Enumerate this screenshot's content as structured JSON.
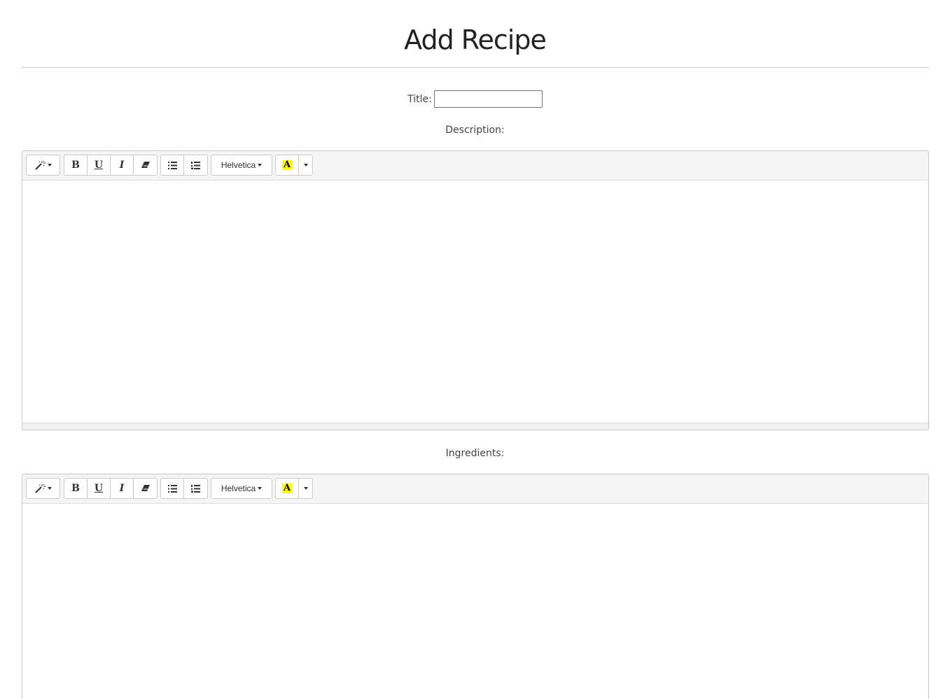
{
  "page": {
    "title": "Add Recipe"
  },
  "form": {
    "title_label": "Title:",
    "title_value": "",
    "title_placeholder": ""
  },
  "editors": {
    "description": {
      "label": "Description:",
      "content": ""
    },
    "ingredients": {
      "label": "Ingredients:",
      "content": ""
    }
  },
  "toolbar": {
    "style_icon": "magic-wand-icon",
    "bold_label": "B",
    "underline_label": "U",
    "italic_label": "I",
    "eraser_icon": "eraser-icon",
    "unordered_list_icon": "unordered-list-icon",
    "ordered_list_icon": "ordered-list-icon",
    "font_name": "Helvetica",
    "color_label": "A",
    "color_highlight": "#ffff00"
  }
}
